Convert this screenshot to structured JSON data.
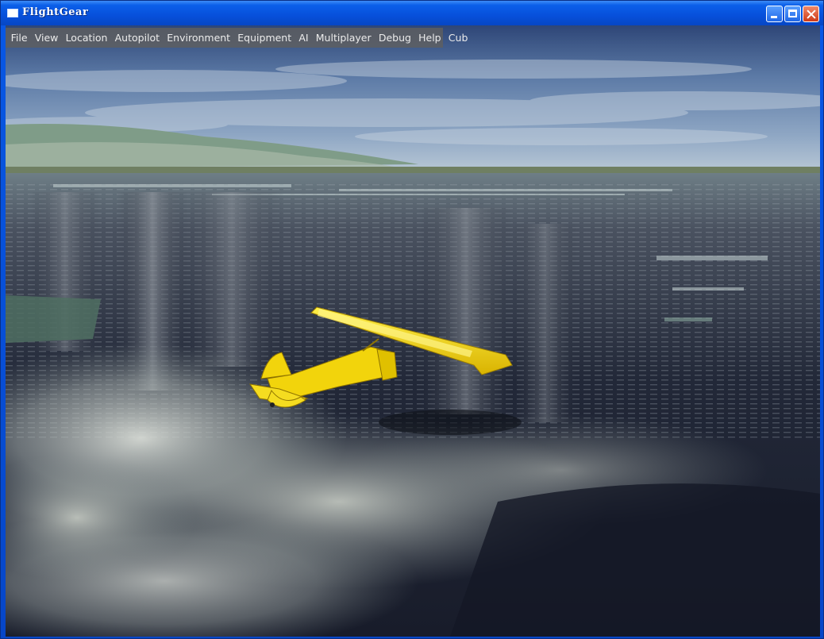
{
  "window": {
    "title": "FlightGear"
  },
  "menubar": {
    "items": [
      {
        "label": "File"
      },
      {
        "label": "View"
      },
      {
        "label": "Location"
      },
      {
        "label": "Autopilot"
      },
      {
        "label": "Environment"
      },
      {
        "label": "Equipment"
      },
      {
        "label": "AI"
      },
      {
        "label": "Multiplayer"
      },
      {
        "label": "Debug"
      },
      {
        "label": "Help"
      },
      {
        "label": "Cub"
      }
    ]
  },
  "scene": {
    "aircraft": "yellow-cub-aircraft",
    "colors": {
      "sky_top": "#2e4677",
      "sky_horizon": "#b9c8d6",
      "terrain_dark": "#1b2030",
      "aircraft": "#f2d40c"
    }
  },
  "icons": {
    "window_icon": "window-icon",
    "minimize": "minimize-icon",
    "maximize": "maximize-icon",
    "close": "close-icon"
  }
}
